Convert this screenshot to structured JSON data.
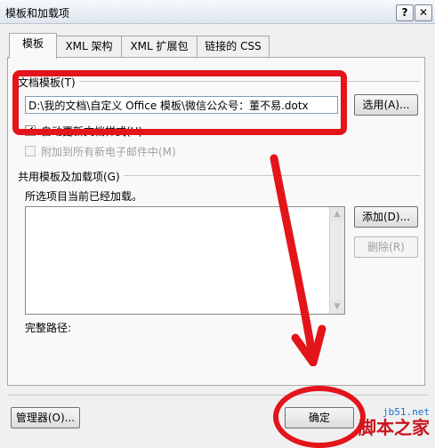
{
  "window": {
    "title": "模板和加载项",
    "help_btn": "?",
    "close_btn": "✕"
  },
  "tabs": [
    {
      "label": "模板",
      "active": true
    },
    {
      "label": "XML 架构"
    },
    {
      "label": "XML 扩展包"
    },
    {
      "label": "链接的 CSS"
    }
  ],
  "document_template": {
    "group_label": "文档模板(T)",
    "path_value": "D:\\我的文档\\自定义 Office 模板\\微信公众号：董不易.dotx",
    "attach_button": "选用(A)...",
    "auto_update_label": "自动更新文档样式(U)",
    "auto_update_checked": true,
    "attach_mail_label": "附加到所有新电子邮件中(M)",
    "attach_mail_checked": false
  },
  "global_templates": {
    "group_label": "共用模板及加载项(G)",
    "hint": "所选项目当前已经加载。",
    "add_button": "添加(D)...",
    "remove_button": "删除(R)",
    "full_path_label": "完整路径:"
  },
  "footer": {
    "organizer_button": "管理器(O)...",
    "ok_button": "确定"
  },
  "watermark": {
    "url": "jb51.net",
    "site": "脚本之家"
  },
  "annotation_color": "#e3141a"
}
